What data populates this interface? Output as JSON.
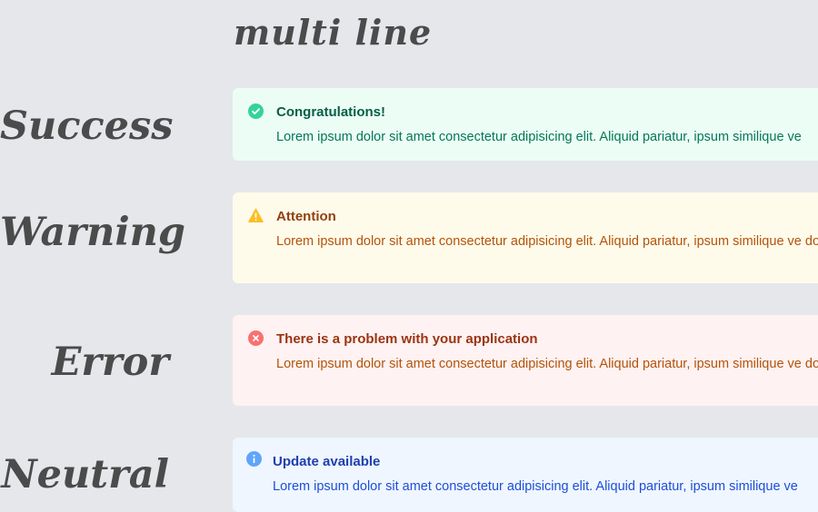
{
  "heading": "multi line",
  "rows": {
    "success": {
      "label": "Success",
      "title": "Congratulations!",
      "body": "Lorem ipsum dolor sit amet consectetur adipisicing elit. Aliquid pariatur, ipsum similique ve",
      "icon": "check-circle-icon",
      "color": "#34d399"
    },
    "warning": {
      "label": "Warning",
      "title": "Attention",
      "body": "Lorem ipsum dolor sit amet consectetur adipisicing elit. Aliquid pariatur, ipsum similique ve dolorum.",
      "icon": "warning-triangle-icon",
      "color": "#fbbf24"
    },
    "error": {
      "label": "Error",
      "title": "There is a problem with your application",
      "body": "Lorem ipsum dolor sit amet consectetur adipisicing elit. Aliquid pariatur, ipsum similique ve dolorum.",
      "icon": "x-circle-icon",
      "color": "#f87171"
    },
    "neutral": {
      "label": "Neutral",
      "title": "Update available",
      "body": "Lorem ipsum dolor sit amet consectetur adipisicing elit. Aliquid pariatur, ipsum similique ve",
      "icon": "info-circle-icon",
      "color": "#60a5fa"
    }
  }
}
